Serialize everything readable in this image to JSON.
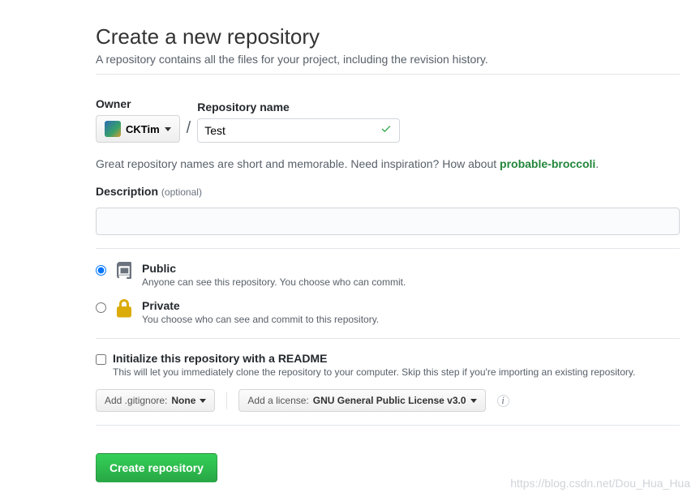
{
  "header": {
    "title": "Create a new repository",
    "subtitle": "A repository contains all the files for your project, including the revision history."
  },
  "owner": {
    "label": "Owner",
    "value": "CKTim"
  },
  "repo": {
    "label": "Repository name",
    "value": "Test"
  },
  "hint": {
    "text_before": "Great repository names are short and memorable. Need inspiration? How about ",
    "suggestion": "probable-broccoli",
    "text_after": "."
  },
  "description": {
    "label": "Description",
    "optional": "(optional)",
    "value": ""
  },
  "visibility": {
    "public": {
      "title": "Public",
      "sub": "Anyone can see this repository. You choose who can commit.",
      "selected": true
    },
    "private": {
      "title": "Private",
      "sub": "You choose who can see and commit to this repository.",
      "selected": false
    }
  },
  "init_readme": {
    "title": "Initialize this repository with a README",
    "sub": "This will let you immediately clone the repository to your computer. Skip this step if you're importing an existing repository.",
    "checked": false
  },
  "gitignore": {
    "prefix": "Add .gitignore: ",
    "value": "None"
  },
  "license": {
    "prefix": "Add a license: ",
    "value": "GNU General Public License v3.0"
  },
  "submit": {
    "label": "Create repository"
  },
  "watermark": "https://blog.csdn.net/Dou_Hua_Hua"
}
